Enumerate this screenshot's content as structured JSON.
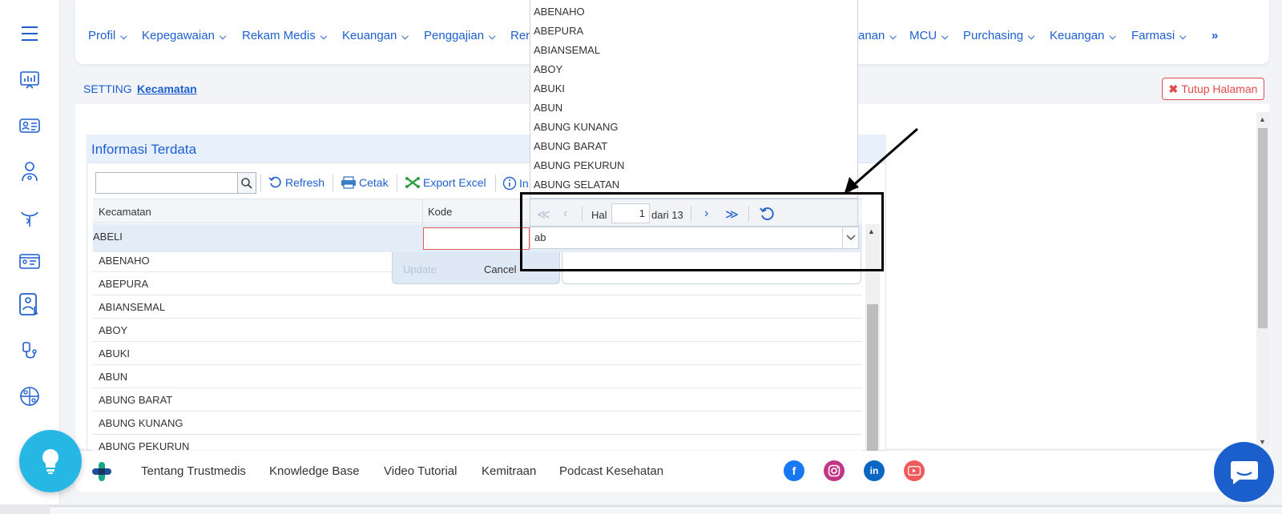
{
  "nav": {
    "items": [
      {
        "label": "Profil"
      },
      {
        "label": "Kepegawaian"
      },
      {
        "label": "Rekam Medis"
      },
      {
        "label": "Keuangan"
      },
      {
        "label": "Penggajian"
      },
      {
        "label": "Ren"
      },
      {
        "label": "anan"
      },
      {
        "label": "MCU"
      },
      {
        "label": "Purchasing"
      },
      {
        "label": "Keuangan"
      },
      {
        "label": "Farmasi"
      }
    ],
    "more": "»"
  },
  "breadcrumb": {
    "parent": "SETTING",
    "current": "Kecamatan"
  },
  "close_page": "Tutup Halaman",
  "panel": {
    "title": "Informasi Terdata"
  },
  "toolbar": {
    "search_value": "",
    "refresh": "Refresh",
    "print": "Cetak",
    "export": "Export Excel",
    "info": "In"
  },
  "grid": {
    "columns": [
      "Kecamatan",
      "Kode"
    ],
    "edit_row": {
      "kecamatan": "ABELI",
      "kode": ""
    },
    "rows": [
      "ABENAHO",
      "ABEPURA",
      "ABIANSEMAL",
      "ABOY",
      "ABUKI",
      "ABUN",
      "ABUNG BARAT",
      "ABUNG KUNANG",
      "ABUNG PEKURUN"
    ],
    "update": "Update",
    "cancel": "Cancel"
  },
  "dropdown": {
    "items": [
      "ABENAHO",
      "ABEPURA",
      "ABIANSEMAL",
      "ABOY",
      "ABUKI",
      "ABUN",
      "ABUNG KUNANG",
      "ABUNG BARAT",
      "ABUNG PEKURUN",
      "ABUNG SELATAN"
    ],
    "pager": {
      "hal_label": "Hal",
      "page": "1",
      "of_label": "dari 13"
    },
    "input_value": "ab"
  },
  "footer": {
    "links": [
      "Tentang Trustmedis",
      "Knowledge Base",
      "Video Tutorial",
      "Kemitraan",
      "Podcast Kesehatan"
    ]
  },
  "colors": {
    "accent": "#1e5fcf",
    "danger": "#e24a4a",
    "facebook": "#1877f2",
    "instagram": "#c13584",
    "linkedin": "#0a66c2",
    "youtube": "#f05a5a"
  }
}
